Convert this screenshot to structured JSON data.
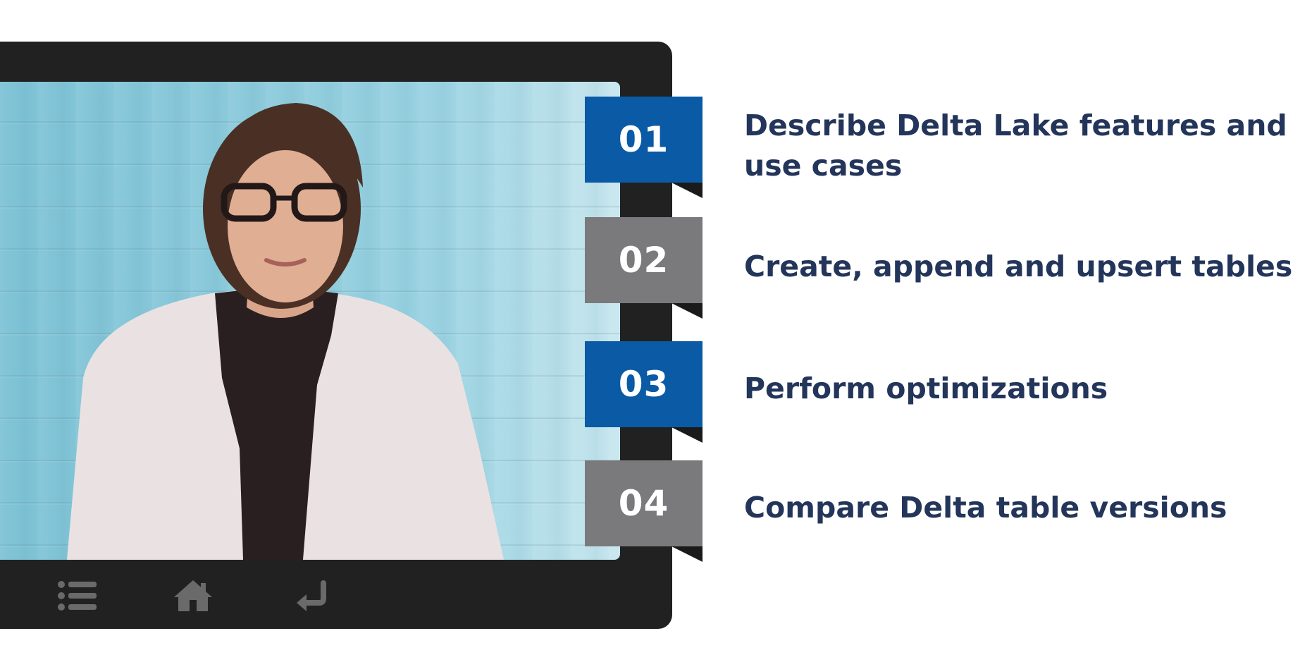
{
  "controls": {
    "menu_icon": "menu-list-icon",
    "home_icon": "home-icon",
    "back_icon": "return-arrow-icon",
    "icon_color": "#6a6a6a"
  },
  "colors": {
    "frame": "#212121",
    "tab_blue": "#0a5aa5",
    "tab_gray": "#7a7a7c",
    "objective_text": "#23355a"
  },
  "objectives": [
    {
      "number": "01",
      "text": "Describe Delta Lake features and use cases"
    },
    {
      "number": "02",
      "text": "Create, append and upsert tables"
    },
    {
      "number": "03",
      "text": "Perform optimizations"
    },
    {
      "number": "04",
      "text": "Compare Delta table versions"
    }
  ]
}
